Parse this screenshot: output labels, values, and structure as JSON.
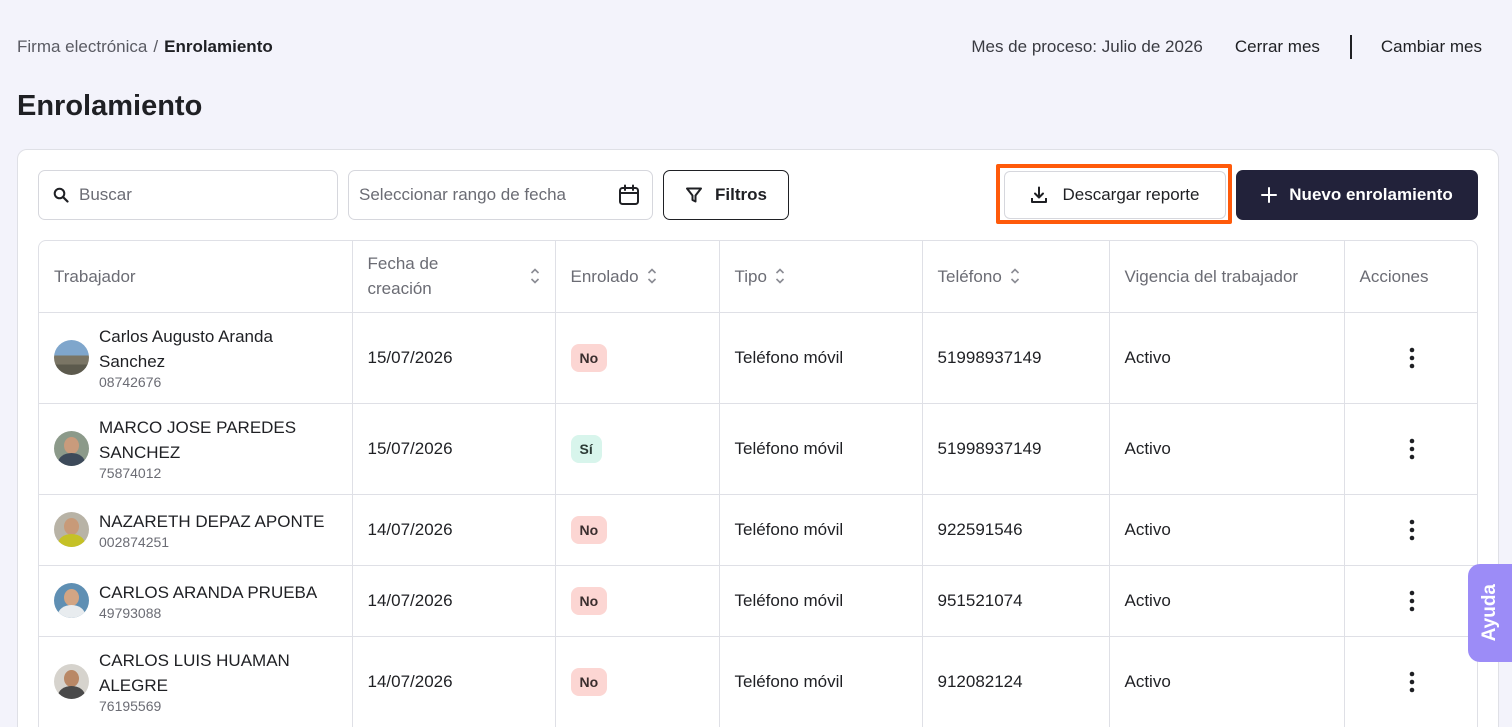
{
  "breadcrumb": {
    "parent": "Firma electrónica",
    "separator": "/",
    "current": "Enrolamiento"
  },
  "header": {
    "process_month": "Mes de proceso: Julio de 2026",
    "close_month": "Cerrar mes",
    "change_month": "Cambiar mes"
  },
  "page_title": "Enrolamiento",
  "toolbar": {
    "search_placeholder": "Buscar",
    "date_placeholder": "Seleccionar rango de fecha",
    "filters_label": "Filtros",
    "download_label": "Descargar reporte",
    "new_label": "Nuevo enrolamiento"
  },
  "table": {
    "columns": [
      "Trabajador",
      "Fecha de creación",
      "Enrolado",
      "Tipo",
      "Teléfono",
      "Vigencia del trabajador",
      "Acciones"
    ],
    "rows": [
      {
        "name": "Carlos Augusto Aranda Sanchez",
        "doc": "08742676",
        "date": "15/07/2026",
        "enrolled": "No",
        "type": "Teléfono móvil",
        "phone": "51998937149",
        "status": "Activo"
      },
      {
        "name": "MARCO JOSE PAREDES SANCHEZ",
        "doc": "75874012",
        "date": "15/07/2026",
        "enrolled": "Sí",
        "type": "Teléfono móvil",
        "phone": "51998937149",
        "status": "Activo"
      },
      {
        "name": "NAZARETH DEPAZ APONTE",
        "doc": "002874251",
        "date": "14/07/2026",
        "enrolled": "No",
        "type": "Teléfono móvil",
        "phone": "922591546",
        "status": "Activo"
      },
      {
        "name": "CARLOS ARANDA PRUEBA",
        "doc": "49793088",
        "date": "14/07/2026",
        "enrolled": "No",
        "type": "Teléfono móvil",
        "phone": "951521074",
        "status": "Activo"
      },
      {
        "name": "CARLOS LUIS HUAMAN ALEGRE",
        "doc": "76195569",
        "date": "14/07/2026",
        "enrolled": "No",
        "type": "Teléfono móvil",
        "phone": "912082124",
        "status": "Activo"
      }
    ]
  },
  "help_tab": "Ayuda",
  "colors": {
    "primary": "#22223a",
    "highlight": "#ff5a0a",
    "badge_no": "#fcd6d3",
    "badge_si": "#d8f5ec",
    "help": "#9c8cf7"
  },
  "icons": {
    "search": "search-icon",
    "calendar": "calendar-icon",
    "filter": "filter-icon",
    "download": "download-icon",
    "plus": "plus-icon",
    "sort": "sort-icon",
    "actions": "kebab-menu-icon"
  }
}
